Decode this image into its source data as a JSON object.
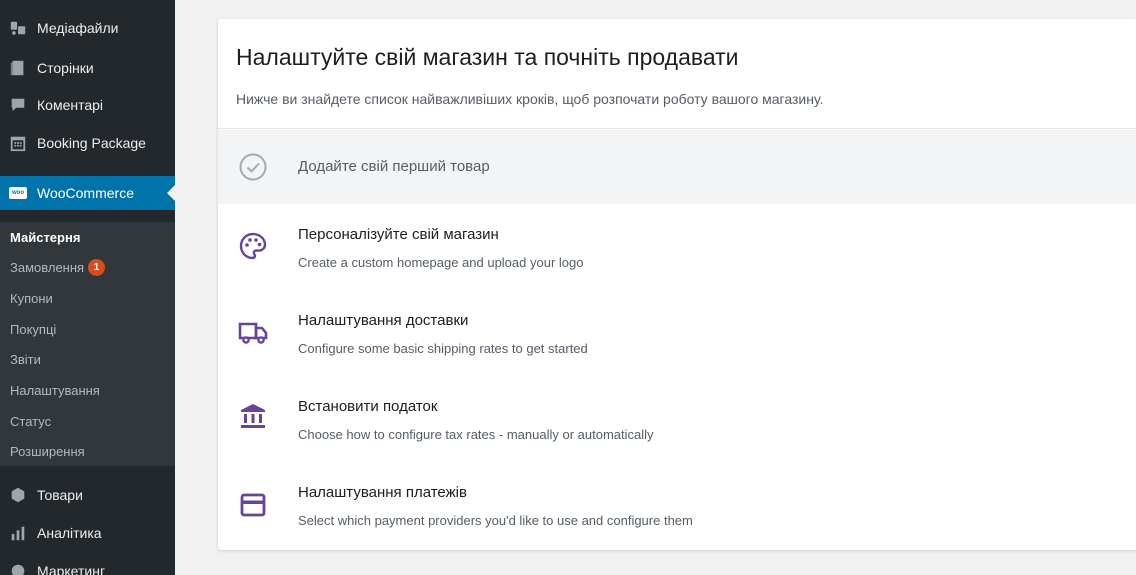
{
  "sidebar": {
    "top_items": [
      {
        "label": "Медіафайли",
        "icon": "media-icon"
      },
      {
        "label": "Сторінки",
        "icon": "pages-icon"
      },
      {
        "label": "Коментарі",
        "icon": "comments-icon"
      },
      {
        "label": "Booking Package",
        "icon": "calendar-icon"
      }
    ],
    "active_item": {
      "label": "WooCommerce",
      "icon_text": "woo",
      "color": "#0073aa"
    },
    "submenu": [
      {
        "label": "Майстерня",
        "current": true
      },
      {
        "label": "Замовлення",
        "badge": "1"
      },
      {
        "label": "Купони"
      },
      {
        "label": "Покупці"
      },
      {
        "label": "Звіти"
      },
      {
        "label": "Налаштування"
      },
      {
        "label": "Статус"
      },
      {
        "label": "Розширення"
      }
    ],
    "bottom_items": [
      {
        "label": "Товари",
        "icon": "products-icon"
      },
      {
        "label": "Аналітика",
        "icon": "analytics-icon"
      },
      {
        "label": "Маркетинг",
        "icon": "marketing-icon"
      }
    ]
  },
  "panel": {
    "title": "Налаштуйте свій магазин та почніть продавати",
    "subtitle": "Нижче ви знайдете список найважливіших кроків, щоб розпочати роботу вашого магазину.",
    "tasks": [
      {
        "title": "Додайте свій перший товар",
        "icon": "check-circle-icon",
        "completed": true
      },
      {
        "title": "Персоналізуйте свій магазин",
        "description": "Create a custom homepage and upload your logo",
        "icon": "palette-icon"
      },
      {
        "title": "Налаштування доставки",
        "description": "Configure some basic shipping rates to get started",
        "icon": "truck-icon"
      },
      {
        "title": "Встановити податок",
        "description": "Choose how to configure tax rates - manually or automatically",
        "icon": "bank-icon"
      },
      {
        "title": "Налаштування платежів",
        "description": "Select which payment providers you'd like to use and configure them",
        "icon": "credit-card-icon"
      }
    ],
    "accent_color": "#674399"
  }
}
